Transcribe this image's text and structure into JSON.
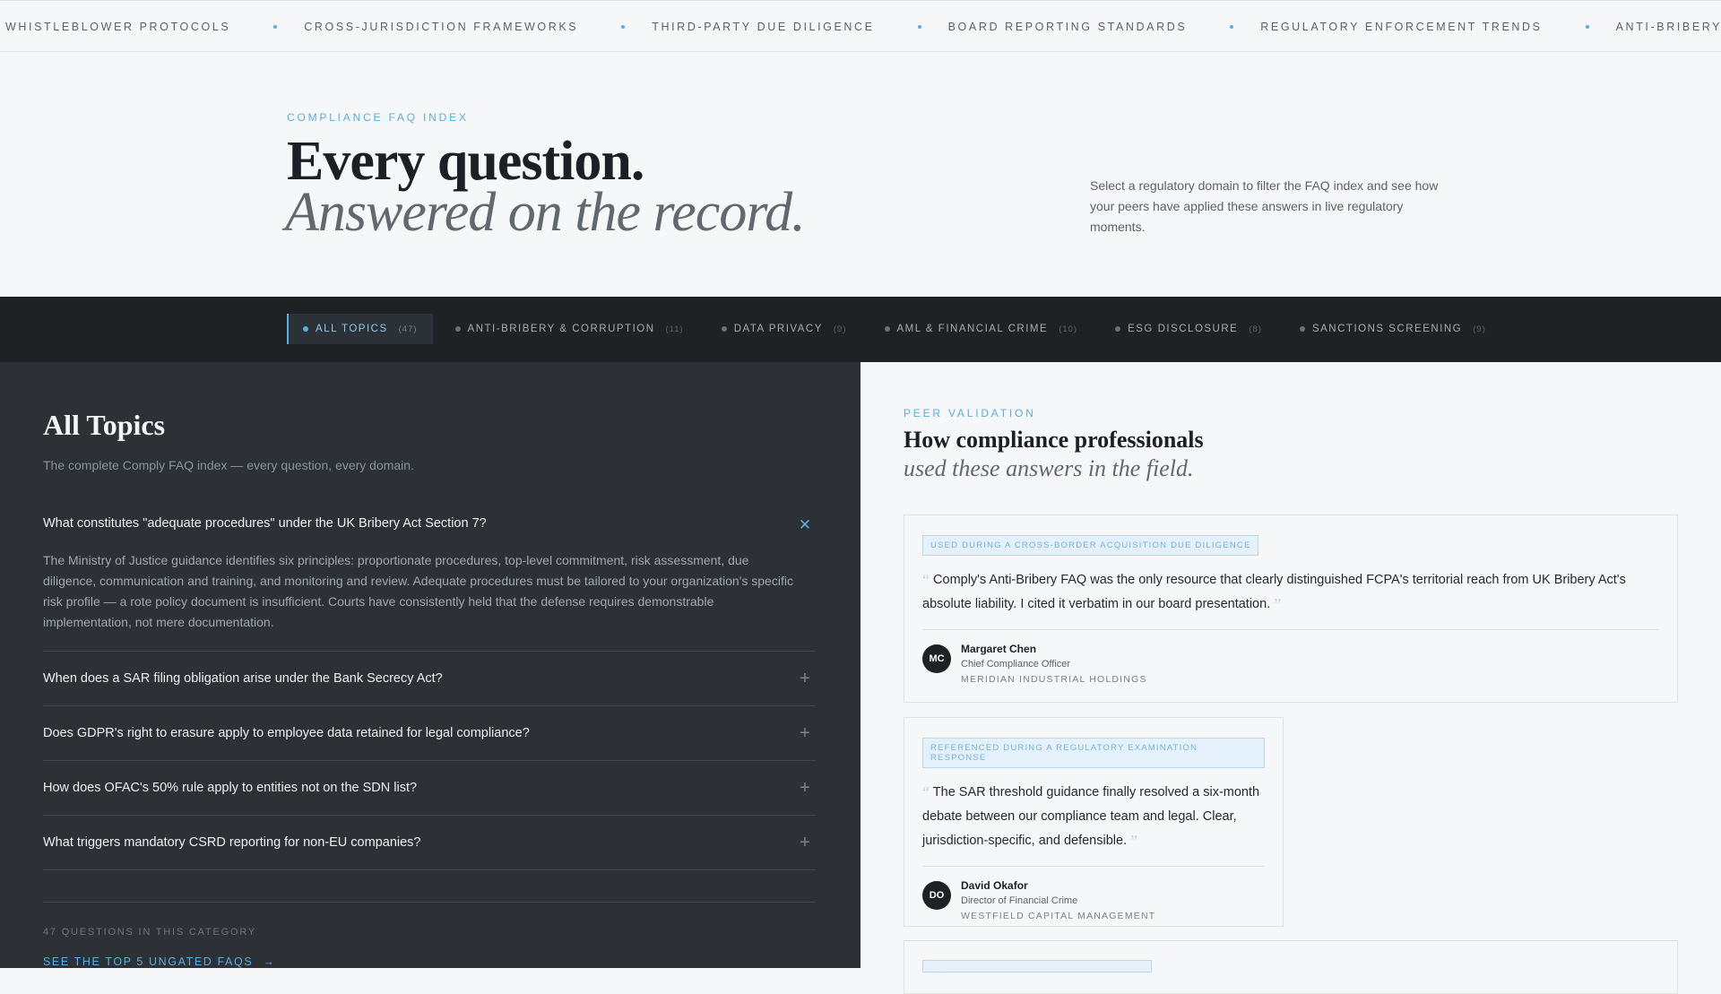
{
  "ticker": {
    "items": [
      "Whistleblower Protocols",
      "Cross-Jurisdiction Frameworks",
      "Third-Party Due Diligence",
      "Board Reporting Standards",
      "Regulatory Enforcement Trends",
      "Anti-Bribery & Corruption"
    ]
  },
  "hero": {
    "eyebrow": "Compliance FAQ Index",
    "title_line1": "Every question.",
    "title_line2": "Answered on the record.",
    "description": "Select a regulatory domain to filter the FAQ index and see how your peers have applied these answers in live regulatory moments."
  },
  "filters": [
    {
      "label": "All Topics",
      "count": "(47)"
    },
    {
      "label": "Anti-Bribery & Corruption",
      "count": "(11)"
    },
    {
      "label": "Data Privacy",
      "count": "(9)"
    },
    {
      "label": "AML & Financial Crime",
      "count": "(10)"
    },
    {
      "label": "ESG Disclosure",
      "count": "(8)"
    },
    {
      "label": "Sanctions Screening",
      "count": "(9)"
    }
  ],
  "left": {
    "title": "All Topics",
    "subtitle": "The complete Comply FAQ index — every question, every domain.",
    "faqs": [
      {
        "q": "What constitutes \"adequate procedures\" under the UK Bribery Act Section 7?",
        "a": "The Ministry of Justice guidance identifies six principles: proportionate procedures, top-level commitment, risk assessment, due diligence, communication and training, and monitoring and review. Adequate procedures must be tailored to your organization's specific risk profile — a rote policy document is insufficient. Courts have consistently held that the defense requires demonstrable implementation, not mere documentation.",
        "toggle": "✕"
      },
      {
        "q": "When does a SAR filing obligation arise under the Bank Secrecy Act?",
        "toggle": "+"
      },
      {
        "q": "Does GDPR's right to erasure apply to employee data retained for legal compliance?",
        "toggle": "+"
      },
      {
        "q": "How does OFAC's 50% rule apply to entities not on the SDN list?",
        "toggle": "+"
      },
      {
        "q": "What triggers mandatory CSRD reporting for non-EU companies?",
        "toggle": "+"
      }
    ],
    "count_text": "47 Questions in this category",
    "link_text": "See the top 5 ungated FAQs",
    "link_arrow": "→"
  },
  "right": {
    "eyebrow": "Peer Validation",
    "title_line1": "How compliance professionals",
    "title_line2": "used these answers in the field.",
    "testimonials": [
      {
        "tag": "Used during a cross-border acquisition due diligence",
        "quote": "Comply's Anti-Bribery FAQ was the only resource that clearly distinguished FCPA's territorial reach from UK Bribery Act's absolute liability. I cited it verbatim in our board presentation.",
        "initials": "MC",
        "name": "Margaret Chen",
        "role": "Chief Compliance Officer",
        "org": "Meridian Industrial Holdings"
      },
      {
        "tag": "Referenced during a regulatory examination response",
        "quote": "The SAR threshold guidance finally resolved a six-month debate between our compliance team and legal. Clear, jurisdiction-specific, and defensible.",
        "initials": "DO",
        "name": "David Okafor",
        "role": "Director of Financial Crime",
        "org": "Westfield Capital Management"
      }
    ],
    "quote_open": "“",
    "quote_close": "”"
  },
  "colors": {
    "accent": "#5aaee0",
    "dark_bar": "#1f2225",
    "dark_panel": "#2d3135",
    "light_bg": "#f6f7f9"
  }
}
